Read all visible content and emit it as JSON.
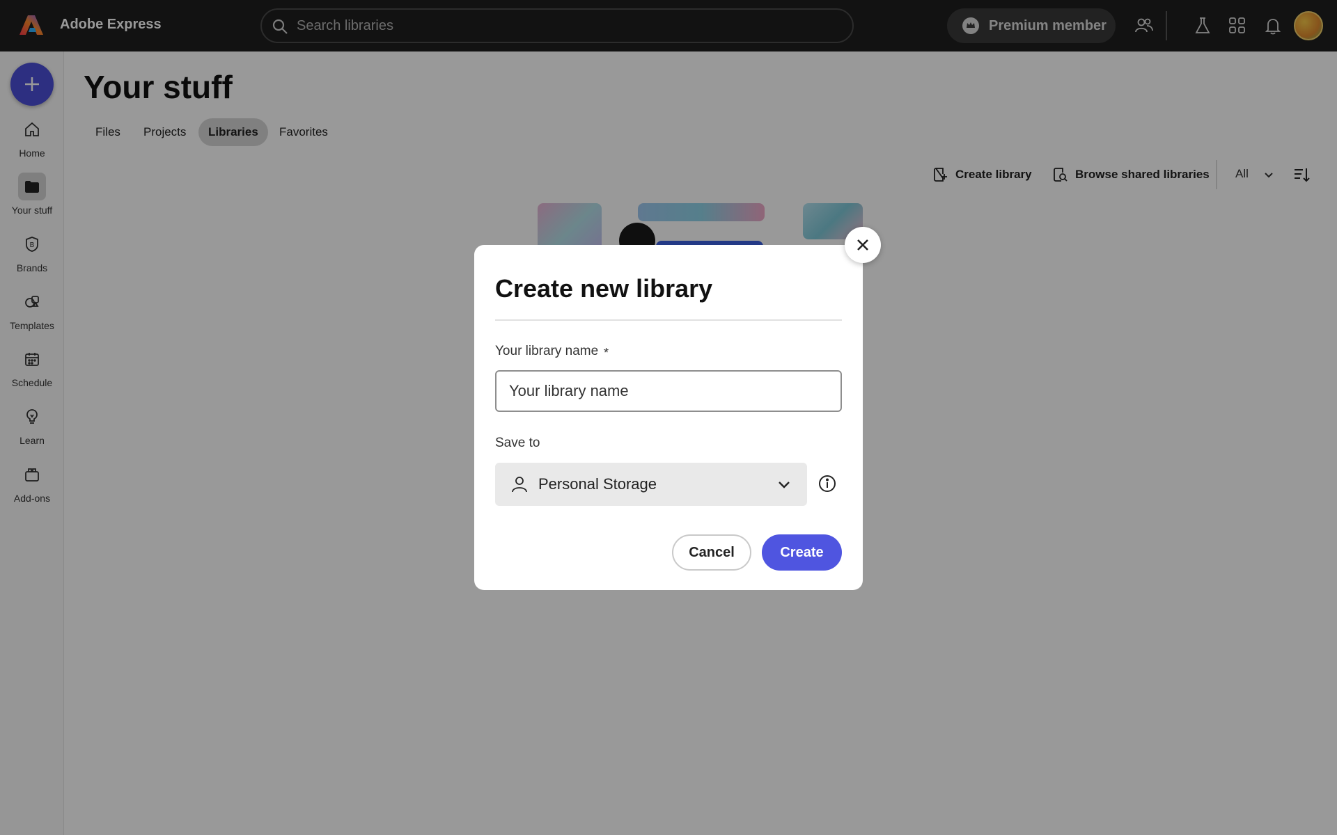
{
  "app": {
    "name": "Adobe Express"
  },
  "search": {
    "placeholder": "Search libraries"
  },
  "header": {
    "premium_label": "Premium member",
    "icons": [
      "people-icon",
      "labs-flask-icon",
      "apps-grid-icon",
      "notification-bell-icon",
      "user-avatar"
    ]
  },
  "sidebar": {
    "create_button": "create-plus",
    "items": [
      {
        "label": "Home",
        "icon": "home-icon"
      },
      {
        "label": "Your stuff",
        "icon": "folder-icon",
        "active": true
      },
      {
        "label": "Brands",
        "icon": "brand-icon"
      },
      {
        "label": "Templates",
        "icon": "templates-icon"
      },
      {
        "label": "Schedule",
        "icon": "calendar-icon"
      },
      {
        "label": "Learn",
        "icon": "lightbulb-icon"
      },
      {
        "label": "Add-ons",
        "icon": "addons-icon"
      }
    ]
  },
  "main": {
    "title": "Your stuff",
    "tabs": [
      {
        "label": "Files"
      },
      {
        "label": "Projects"
      },
      {
        "label": "Libraries",
        "active": true
      },
      {
        "label": "Favorites"
      }
    ],
    "actions": {
      "create_library": "Create library",
      "browse_shared": "Browse shared libraries",
      "filter_value": "All"
    }
  },
  "dialog": {
    "title": "Create new library",
    "name_label": "Your library name",
    "required_mark": "*",
    "name_placeholder": "Your library name",
    "name_value": "",
    "save_to_label": "Save to",
    "save_to_value": "Personal Storage",
    "cancel_label": "Cancel",
    "create_label": "Create"
  },
  "colors": {
    "accent": "#4f55e0",
    "fab": "#4b4fd8",
    "topbar": "#1e1e1e"
  }
}
